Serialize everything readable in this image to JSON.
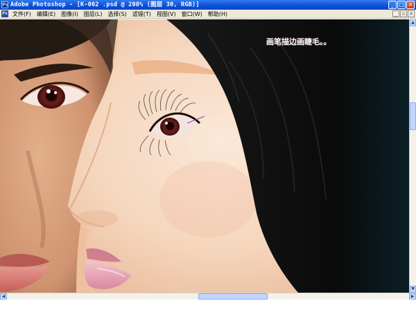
{
  "window": {
    "title": "Adobe Photoshop - [K-002 .psd @ 200% (图层 30, RGB)]",
    "app_icon": "photoshop-icon",
    "controls": [
      "minimize",
      "maximize",
      "close"
    ]
  },
  "menubar": {
    "icon": "photoshop-doc-icon",
    "items": [
      {
        "label": "文件(F)"
      },
      {
        "label": "编辑(E)"
      },
      {
        "label": "图像(I)"
      },
      {
        "label": "图层(L)"
      },
      {
        "label": "选择(S)"
      },
      {
        "label": "滤镜(T)"
      },
      {
        "label": "视图(V)"
      },
      {
        "label": "窗口(W)"
      },
      {
        "label": "帮助(H)"
      }
    ],
    "doc_controls": [
      "minimize",
      "restore",
      "close"
    ]
  },
  "canvas": {
    "annotation": "画笔描边画睫毛。。"
  },
  "colors": {
    "title_bar": "#0b4fd6",
    "menu_bg": "#ece9d8",
    "skin": "#f2d2b6",
    "hair": "#0e0e0e",
    "annotation_text": "#ffffff"
  }
}
